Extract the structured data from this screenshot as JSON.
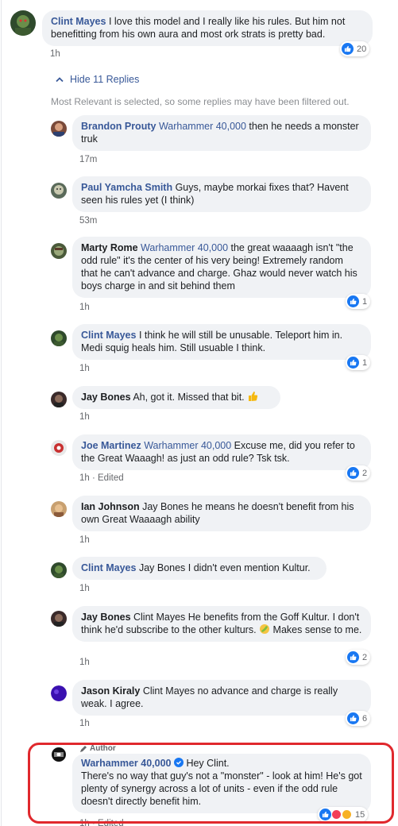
{
  "top_comment": {
    "author": "Clint Mayes",
    "text": " I love this model and I really like his rules. But him not benefitting from his own aura and most ork strats is pretty bad.",
    "time": "1h",
    "reactions": "20"
  },
  "replies_toggle": {
    "label": "Hide 11 Replies"
  },
  "filter_notice": "Most Relevant is selected, so some replies may have been filtered out.",
  "replies": [
    {
      "author": "Brandon Prouty",
      "tag": "Warhammer 40,000",
      "text": " then he needs a monster truk",
      "time": "17m",
      "reactions": ""
    },
    {
      "author": "Paul Yamcha Smith",
      "tag": "",
      "text": " Guys, maybe morkai fixes that? Havent seen his rules yet (I think)",
      "time": "53m",
      "reactions": ""
    },
    {
      "author": "Marty Rome",
      "tag": "Warhammer 40,000",
      "text": " the great waaaagh isn't \"the odd rule\" it's the center of his very being! Extremely random that he can't advance and charge. Ghaz would never watch his boys charge in and sit behind them",
      "time": "1h",
      "reactions": "1"
    },
    {
      "author": "Clint Mayes",
      "tag": "",
      "text": " I think he will still be unusable. Teleport him in. Medi squig heals him. Still usuable I think.",
      "time": "1h",
      "reactions": "1"
    },
    {
      "author": "Jay Bones",
      "tag": "",
      "text": " Ah, got it. Missed that bit.",
      "time": "1h",
      "reactions": ""
    },
    {
      "author": "Joe Martinez",
      "tag": "Warhammer 40,000",
      "text": " Excuse me, did you refer to the Great Waaagh! as just an odd rule? Tsk tsk.",
      "time": "1h · Edited",
      "reactions": "2"
    },
    {
      "author": "Ian Johnson",
      "tag": "",
      "text": " Jay Bones he means he doesn't benefit from his own Great Waaaagh ability",
      "time": "1h",
      "reactions": ""
    },
    {
      "author": "Clint Mayes",
      "tag": "",
      "text": " Jay Bones I didn't even mention Kultur.",
      "time": "1h",
      "reactions": ""
    },
    {
      "author": "Jay Bones",
      "tag": "",
      "text": " Clint Mayes He benefits from the Goff Kultur. I don't think he'd subscribe to the other kulturs.",
      "text2": " Makes sense to me.",
      "time": "1h",
      "reactions": "2"
    },
    {
      "author": "Jason Kiraly",
      "tag": "",
      "text": " Clint Mayes no advance and charge is really weak. I agree.",
      "time": "1h",
      "reactions": "6"
    }
  ],
  "author_reply": {
    "badge": "Author",
    "author": "Warhammer 40,000",
    "text_line1": " Hey Clint.",
    "text_rest": "There's no way that guy's not a \"monster\" - look at him! He's got plenty of synergy across a lot of units - even if the odd rule doesn't directly benefit him.",
    "time": "1h · Edited",
    "reactions": "15"
  },
  "colors": {
    "link": "#385898",
    "bubble": "#f0f2f5",
    "like": "#1877f2",
    "highlight": "#e0282d"
  },
  "icons": [
    "chevron-up-icon",
    "like-icon",
    "love-icon",
    "haha-icon",
    "thumbs-up-emoji",
    "facepalm-emoji",
    "pencil-icon",
    "verified-icon"
  ]
}
